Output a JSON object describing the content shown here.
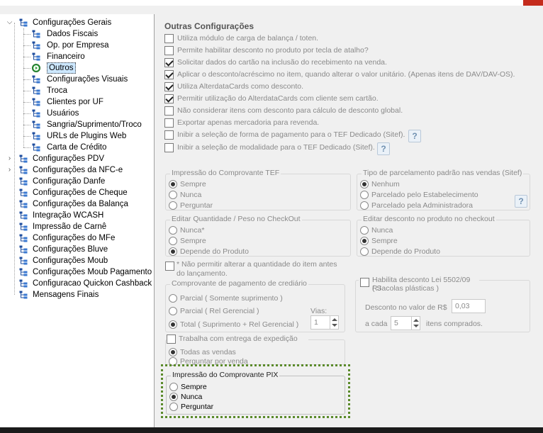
{
  "tree": {
    "items": [
      {
        "label": "Configurações Gerais",
        "expander": "open",
        "icon": "tree-icon"
      },
      {
        "label": "Dados Fiscais",
        "icon": "tree-icon"
      },
      {
        "label": "Op. por Empresa",
        "icon": "tree-icon"
      },
      {
        "label": "Financeiro",
        "icon": "tree-icon"
      },
      {
        "label": "Outros",
        "icon": "green-play-icon",
        "selected": true
      },
      {
        "label": "Configurações Visuais",
        "icon": "tree-icon"
      },
      {
        "label": "Troca",
        "icon": "tree-icon"
      },
      {
        "label": "Clientes por UF",
        "icon": "tree-icon"
      },
      {
        "label": "Usuários",
        "icon": "tree-icon"
      },
      {
        "label": "Sangria/Suprimento/Troco",
        "icon": "tree-icon"
      },
      {
        "label": "URLs de Plugins Web",
        "icon": "tree-icon"
      },
      {
        "label": "Carta de Crédito",
        "icon": "tree-icon"
      },
      {
        "label": "Configurações PDV",
        "expander": "closed",
        "icon": "tree-icon"
      },
      {
        "label": "Configurações da NFC-e",
        "expander": "closed",
        "icon": "tree-icon"
      },
      {
        "label": "Configuração Danfe",
        "icon": "tree-icon"
      },
      {
        "label": "Configurações de Cheque",
        "icon": "tree-icon"
      },
      {
        "label": "Configurações da Balança",
        "icon": "tree-icon"
      },
      {
        "label": "Integração WCASH",
        "icon": "tree-icon"
      },
      {
        "label": "Impressão de Carnê",
        "icon": "tree-icon"
      },
      {
        "label": "Configurações do MFe",
        "icon": "tree-icon"
      },
      {
        "label": "Configurações Bluve",
        "icon": "tree-icon"
      },
      {
        "label": "Configurações Moub",
        "icon": "tree-icon"
      },
      {
        "label": "Configurações Moub Pagamento",
        "icon": "tree-icon"
      },
      {
        "label": "Configuracao Quickon Cashback",
        "icon": "tree-icon"
      },
      {
        "label": "Mensagens Finais",
        "icon": "tree-icon"
      }
    ]
  },
  "panel": {
    "title": "Outras Configurações",
    "checkboxes": [
      {
        "label": "Utiliza módulo de carga de balança / toten.",
        "checked": false
      },
      {
        "label": "Permite habilitar desconto no produto por tecla de atalho?",
        "checked": false
      },
      {
        "label": "Solicitar dados do cartão na inclusão do recebimento na venda.",
        "checked": true
      },
      {
        "label": "Aplicar o desconto/acréscimo no item, quando alterar o valor unitário. (Apenas itens de DAV/DAV-OS).",
        "checked": true
      },
      {
        "label": "Utiliza AlterdataCards como desconto.",
        "checked": true
      },
      {
        "label": "Permitir utilização do AlterdataCards com cliente sem cartão.",
        "checked": true
      },
      {
        "label": "Não considerar itens com desconto para cálculo de desconto global.",
        "checked": false
      },
      {
        "label": "Exportar apenas mercadoria para revenda.",
        "checked": false
      },
      {
        "label": "Inibir a seleção de forma de pagamento para o TEF Dedicado (Sitef).",
        "checked": false
      },
      {
        "label": "Inibir a seleção de modalidade para o TEF Dedicado (Sitef).",
        "checked": false
      }
    ],
    "help_glyph": "?",
    "tef_print": {
      "title": "Impressão do Comprovante TEF",
      "options": [
        "Sempre",
        "Nunca",
        "Perguntar"
      ],
      "selected": "Sempre"
    },
    "installment": {
      "title": "Tipo de parcelamento padrão nas vendas (Sitef)",
      "options": [
        "Nenhum",
        "Parcelado pelo Estabelecimento",
        "Parcelado pela Administradora"
      ],
      "selected": "Nenhum"
    },
    "edit_qty": {
      "title": "Editar Quantidade / Peso no CheckOut",
      "options": [
        "Nunca*",
        "Sempre",
        "Depende do Produto"
      ],
      "selected": "Depende do Produto"
    },
    "edit_discount": {
      "title": "Editar desconto no produto no checkout",
      "options": [
        "Nunca",
        "Sempre",
        "Depende do Produto"
      ],
      "selected": "Sempre"
    },
    "no_qty_change": {
      "label_line1": "* Não permitir alterar a quantidade do item antes",
      "label_line2": "do lançamento.",
      "checked": false
    },
    "credit_receipt": {
      "title": "Comprovante de pagamento de crediário",
      "options": [
        "Parcial ( Somente suprimento )",
        "Parcial ( Rel Gerencial )",
        "Total ( Suprimento + Rel Gerencial )"
      ],
      "selected": "Total ( Suprimento + Rel Gerencial )",
      "vias_label": "Vias:",
      "vias_value": "1"
    },
    "law_discount": {
      "label_line1": "Habilita desconto Lei 5502/09 RJ",
      "label_line2": "( Sacolas plásticas )",
      "checked": false,
      "discount_label": "Desconto no valor de R$",
      "discount_value": "0,03",
      "each_label": "a cada",
      "each_value": "5",
      "items_label": "itens comprados."
    },
    "delivery": {
      "label": "Trabalha com entrega de expedição",
      "checked": false,
      "options": [
        "Todas as vendas",
        "Perguntar por venda"
      ],
      "selected": "Todas as vendas"
    },
    "pix_print": {
      "title": "Impressão do Comprovante PIX",
      "options": [
        "Sempre",
        "Nunca",
        "Perguntar"
      ],
      "selected": "Nunca",
      "highlight_color": "#5a8a2a"
    }
  },
  "colors": {
    "selection": "#cde8ff",
    "disabled_text": "#8a8a8a",
    "close_button": "#c42b1c"
  }
}
